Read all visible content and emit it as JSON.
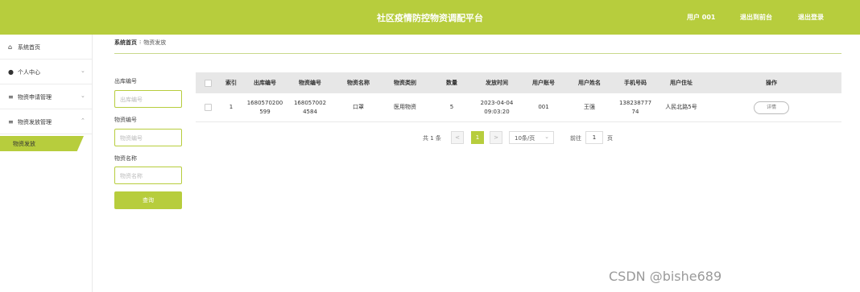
{
  "header": {
    "title": "社区疫情防控物资调配平台",
    "user": "用户 001",
    "back_to_front": "退出到前台",
    "logout": "退出登录"
  },
  "sidebar": {
    "items": [
      {
        "icon": "home-icon",
        "label": "系统首页"
      },
      {
        "icon": "user-icon",
        "label": "个人中心"
      },
      {
        "icon": "menu-icon",
        "label": "物资申请管理"
      },
      {
        "icon": "menu-icon",
        "label": "物资发放管理"
      }
    ],
    "active_sub": "物资发放"
  },
  "breadcrumb": {
    "home": "系统首页",
    "separator": "⁝",
    "current": "物资发放"
  },
  "filters": {
    "outbound_no": {
      "label": "出库编号",
      "placeholder": "出库编号"
    },
    "material_no": {
      "label": "物资编号",
      "placeholder": "物资编号"
    },
    "material_name": {
      "label": "物资名称",
      "placeholder": "物资名称"
    },
    "query_button": "查询"
  },
  "table": {
    "columns": [
      "索引",
      "出库编号",
      "物资编号",
      "物资名称",
      "物资类别",
      "数量",
      "发放时间",
      "用户账号",
      "用户姓名",
      "手机号码",
      "用户住址",
      "操作"
    ],
    "rows": [
      {
        "index": "1",
        "outbound_no_1": "1680570200",
        "outbound_no_2": "599",
        "material_no_1": "168057002",
        "material_no_2": "4584",
        "material_name": "口罩",
        "category": "医用物资",
        "quantity": "5",
        "time_1": "2023-04-04",
        "time_2": "09:03:20",
        "account": "001",
        "name": "王强",
        "phone_1": "138238777",
        "phone_2": "74",
        "address": "人民北路5号",
        "action": "详情"
      }
    ]
  },
  "pagination": {
    "total": "共 1 条",
    "prev": "<",
    "current_page": "1",
    "next": ">",
    "page_size": "10条/页",
    "jump_prefix": "前往",
    "jump_value": "1",
    "jump_suffix": "页"
  },
  "watermark": "CSDN @bishe689",
  "colors": {
    "accent": "#b7cd3d"
  }
}
